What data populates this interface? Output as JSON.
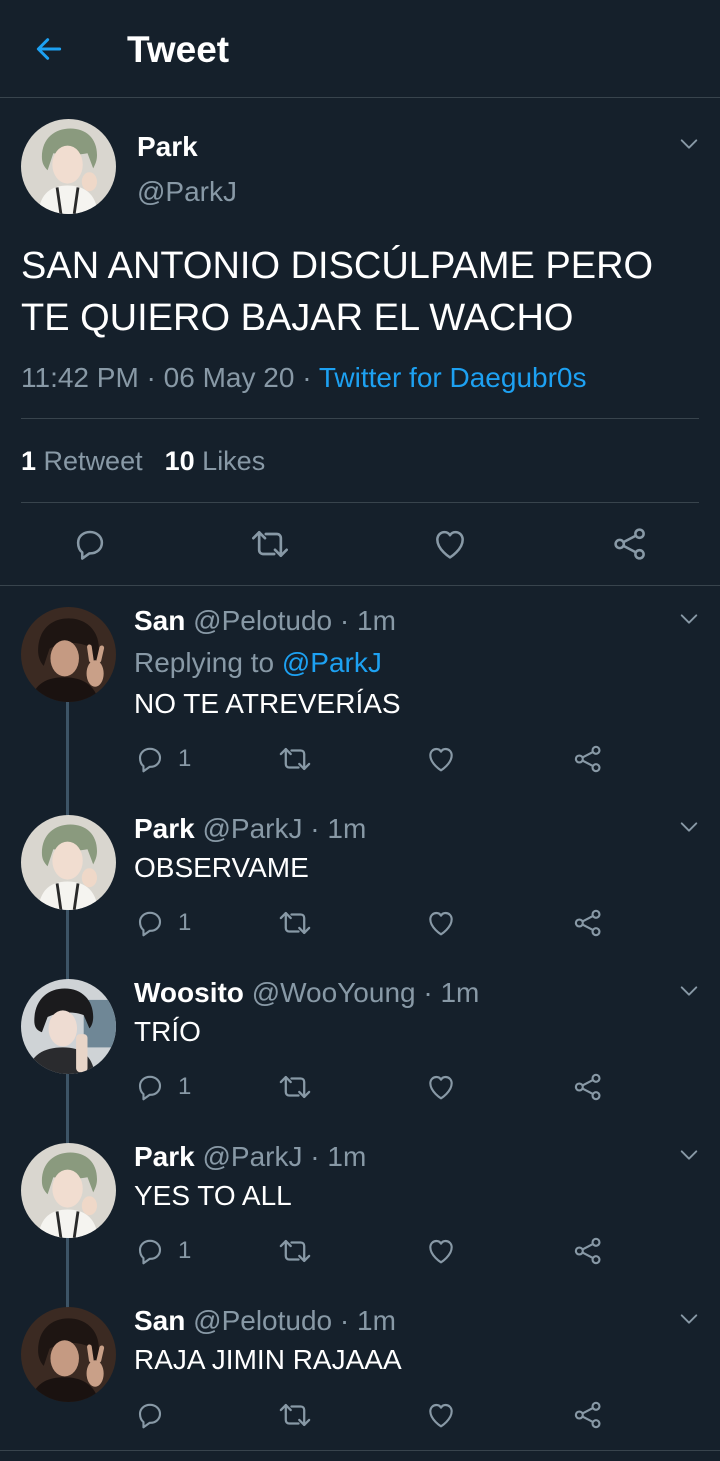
{
  "header": {
    "title": "Tweet"
  },
  "main_tweet": {
    "name": "Park",
    "handle": "@ParkJ",
    "text_lines": [
      "SAN ANTONIO DISCÚLPAME PERO",
      "TE QUIERO BAJAR EL WACHO"
    ],
    "time": "11:42 PM",
    "separator": " · ",
    "date": "06 May 20",
    "client": "Twitter for Daegubr0s",
    "retweets_count": "1",
    "retweets_label": "Retweet",
    "likes_count": "10",
    "likes_label": "Likes"
  },
  "replies": [
    {
      "name": "San",
      "handle": "@Pelotudo",
      "time": "· 1m",
      "replying_prefix": "Replying to",
      "replying_to": "@ParkJ",
      "text": "NO TE ATREVERÍAS",
      "reply_count": "1"
    },
    {
      "name": "Park",
      "handle": "@ParkJ",
      "time": "· 1m",
      "text": "OBSERVAME",
      "reply_count": "1"
    },
    {
      "name": "Woosito",
      "handle": "@WooYoung",
      "time": "· 1m",
      "text": "TRÍO",
      "reply_count": "1"
    },
    {
      "name": "Park",
      "handle": "@ParkJ",
      "time": "· 1m",
      "text": "YES TO ALL",
      "reply_count": "1"
    },
    {
      "name": "San",
      "handle": "@Pelotudo",
      "time": "· 1m",
      "text": "RAJA JIMIN RAJAAA",
      "reply_count": ""
    }
  ],
  "colors": {
    "background": "#15202b",
    "accent": "#1da1f2",
    "secondary_text": "#8899a6",
    "divider": "#38444d",
    "thread_line": "#3d5466"
  },
  "icons": {
    "back": "arrow-left-icon",
    "menu": "chevron-down-icon",
    "reply": "speech-bubble-icon",
    "retweet": "retweet-icon",
    "like": "heart-icon",
    "share": "share-icon"
  }
}
